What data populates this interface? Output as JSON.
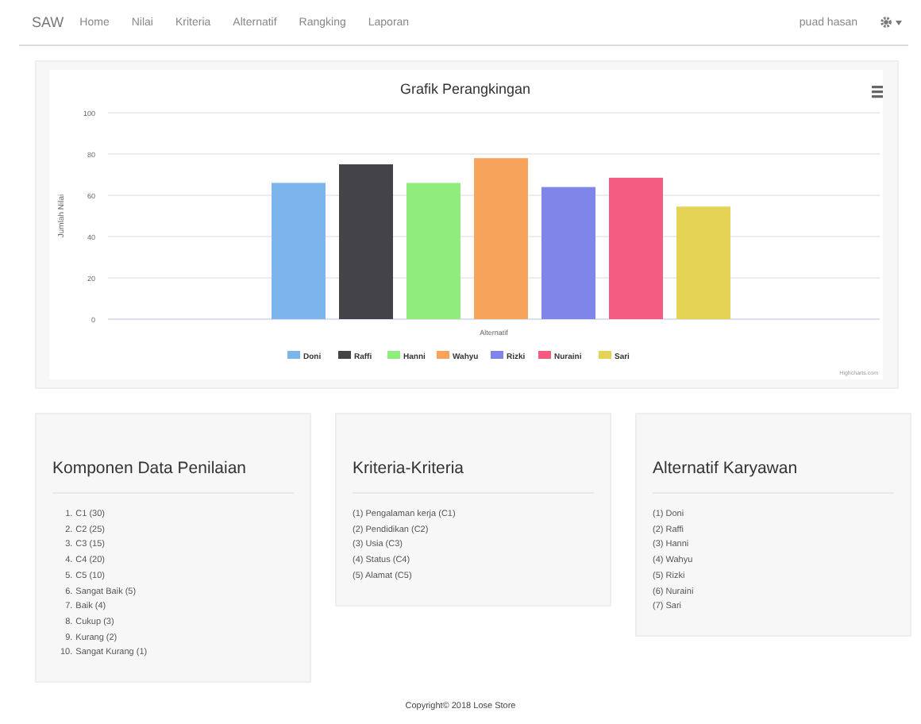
{
  "navbar": {
    "brand": "SAW",
    "links": [
      "Home",
      "Nilai",
      "Kriteria",
      "Alternatif",
      "Rangking",
      "Laporan"
    ],
    "user": "puad hasan"
  },
  "chart": {
    "chart_data": {
      "type": "bar",
      "grid": true,
      "legend": true,
      "title": "Grafik Perangkingan",
      "xlabel": "Alternatif",
      "ylabel": "Jumlah Nilai",
      "ylim": [
        0,
        100
      ],
      "yticks": [
        0,
        20,
        40,
        60,
        80,
        100
      ],
      "series": [
        {
          "name": "Doni",
          "color": "#7cb5ec",
          "values": [
            66
          ]
        },
        {
          "name": "Raffi",
          "color": "#434348",
          "values": [
            75
          ]
        },
        {
          "name": "Hanni",
          "color": "#90ed7d",
          "values": [
            66
          ]
        },
        {
          "name": "Wahyu",
          "color": "#f7a35c",
          "values": [
            78
          ]
        },
        {
          "name": "Rizki",
          "color": "#8085e9",
          "values": [
            64
          ]
        },
        {
          "name": "Nuraini",
          "color": "#f15c80",
          "values": [
            68.5
          ]
        },
        {
          "name": "Sari",
          "color": "#e4d354",
          "values": [
            54.5
          ]
        }
      ]
    },
    "credit": "Highcharts.com"
  },
  "panels": [
    {
      "title": "Komponen Data Penilaian",
      "kind": "numbered",
      "items": [
        {
          "number": "1.",
          "text": "C1 (30)"
        },
        {
          "number": "2.",
          "text": "C2 (25)"
        },
        {
          "number": "3.",
          "text": "C3 (15)"
        },
        {
          "number": "4.",
          "text": "C4 (20)"
        },
        {
          "number": "5.",
          "text": "C5 (10)"
        },
        {
          "number": "6.",
          "text": "Sangat Baik (5)"
        },
        {
          "number": "7.",
          "text": "Baik (4)"
        },
        {
          "number": "8.",
          "text": "Cukup (3)"
        },
        {
          "number": "9.",
          "text": "Kurang (2)"
        },
        {
          "number": "10.",
          "text": "Sangat Kurang (1)"
        }
      ]
    },
    {
      "title": "Kriteria-Kriteria",
      "kind": "plain",
      "items": [
        "(1) Pengalaman kerja (C1)",
        "(2) Pendidikan (C2)",
        "(3) Usia (C3)",
        "(4) Status (C4)",
        "(5) Alamat (C5)"
      ]
    },
    {
      "title": "Alternatif Karyawan",
      "kind": "plain",
      "items": [
        "(1) Doni",
        "(2) Raffi",
        "(3) Hanni",
        "(4) Wahyu",
        "(5) Rizki",
        "(6) Nuraini",
        "(7) Sari"
      ]
    }
  ],
  "footer": "Copyright© 2018 Lose Store"
}
